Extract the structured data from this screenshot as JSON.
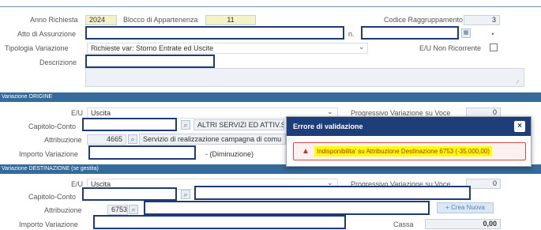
{
  "header": {
    "anno_label": "Anno Richiesta",
    "anno_value": "2024",
    "blocco_label": "Blocco di Appartenenza",
    "blocco_value": "11",
    "codice_label": "Codice Raggruppamento",
    "codice_value": "3",
    "atto_label": "Atto di Assunzione",
    "n_label": "n.",
    "tipologia_label": "Tipologia Variazione",
    "tipologia_value": "Richieste var: Storno Entrate ed Uscite",
    "eu_non_ricorrente_label": "E/U Non Ricorrente",
    "descrizione_label": "Descrizione"
  },
  "origine": {
    "section_title": "Variazione ORIGINE",
    "eu_label": "E/U",
    "eu_value": "Uscita",
    "progressivo_label": "Progressivo Variazione su Voce",
    "progressivo_value": "0",
    "capitolo_label": "Capitolo-Conto",
    "capitolo_desc": "ALTRI SERVIZI ED ATTIV.STI",
    "attribuzione_label": "Attribuzione",
    "attribuzione_code": "4665",
    "attribuzione_desc": "Servizio di realizzazione campagna di comu",
    "importo_label": "Importo Variazione",
    "diminuzione": "- (Diminuzione)"
  },
  "destinazione": {
    "section_title": "Variazione DESTINAZIONE (se gestita)",
    "eu_label": "E/U",
    "eu_value": "Uscita",
    "progressivo_label": "Progressivo Variazione su Voce",
    "progressivo_value": "0",
    "capitolo_label": "Capitolo-Conto",
    "attribuzione_label": "Attribuzione",
    "attribuzione_code": "6753",
    "crea_nuova_label": "+ Crea Nuova",
    "importo_label": "Importo Variazione",
    "cassa_label": "Cassa",
    "cassa_value": "0,00"
  },
  "dialog": {
    "title": "Errore di validazione",
    "close_icon": "close-icon",
    "warning_icon": "warning-icon",
    "message": "Indisponibilita' su Attribuzione Destinazione 6753 (-35.000,00)"
  },
  "colors": {
    "section_bar": "#356a9c",
    "dialog_header": "#1d3e78",
    "highlight": "#ffff00",
    "error_text": "#b32c28",
    "annotation_border": "#1f3a78"
  }
}
